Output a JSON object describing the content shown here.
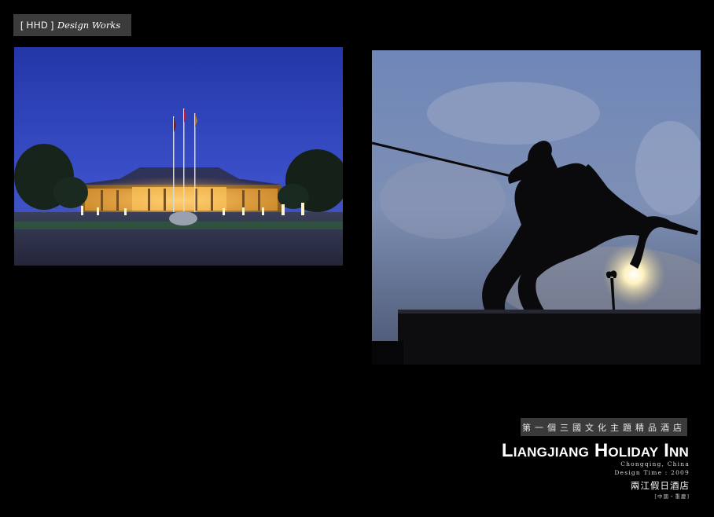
{
  "header": {
    "brand": "[ HHD ]",
    "works": "Design Works"
  },
  "project": {
    "subtitle_cn": "第一個三國文化主題精品酒店",
    "title": "Liangjiang Holiday Inn",
    "location": "Chongqing, China",
    "design_time": "Design Time : 2009",
    "name_cn": "兩江假日酒店",
    "location_cn": "[中國・重慶]"
  },
  "colors": {
    "background": "#000000",
    "tag_bg": "#3b3b3b",
    "band_bg": "#3a3a3a",
    "dusk_sky": "#2c3fb8",
    "warm_light": "#f0b84a"
  }
}
